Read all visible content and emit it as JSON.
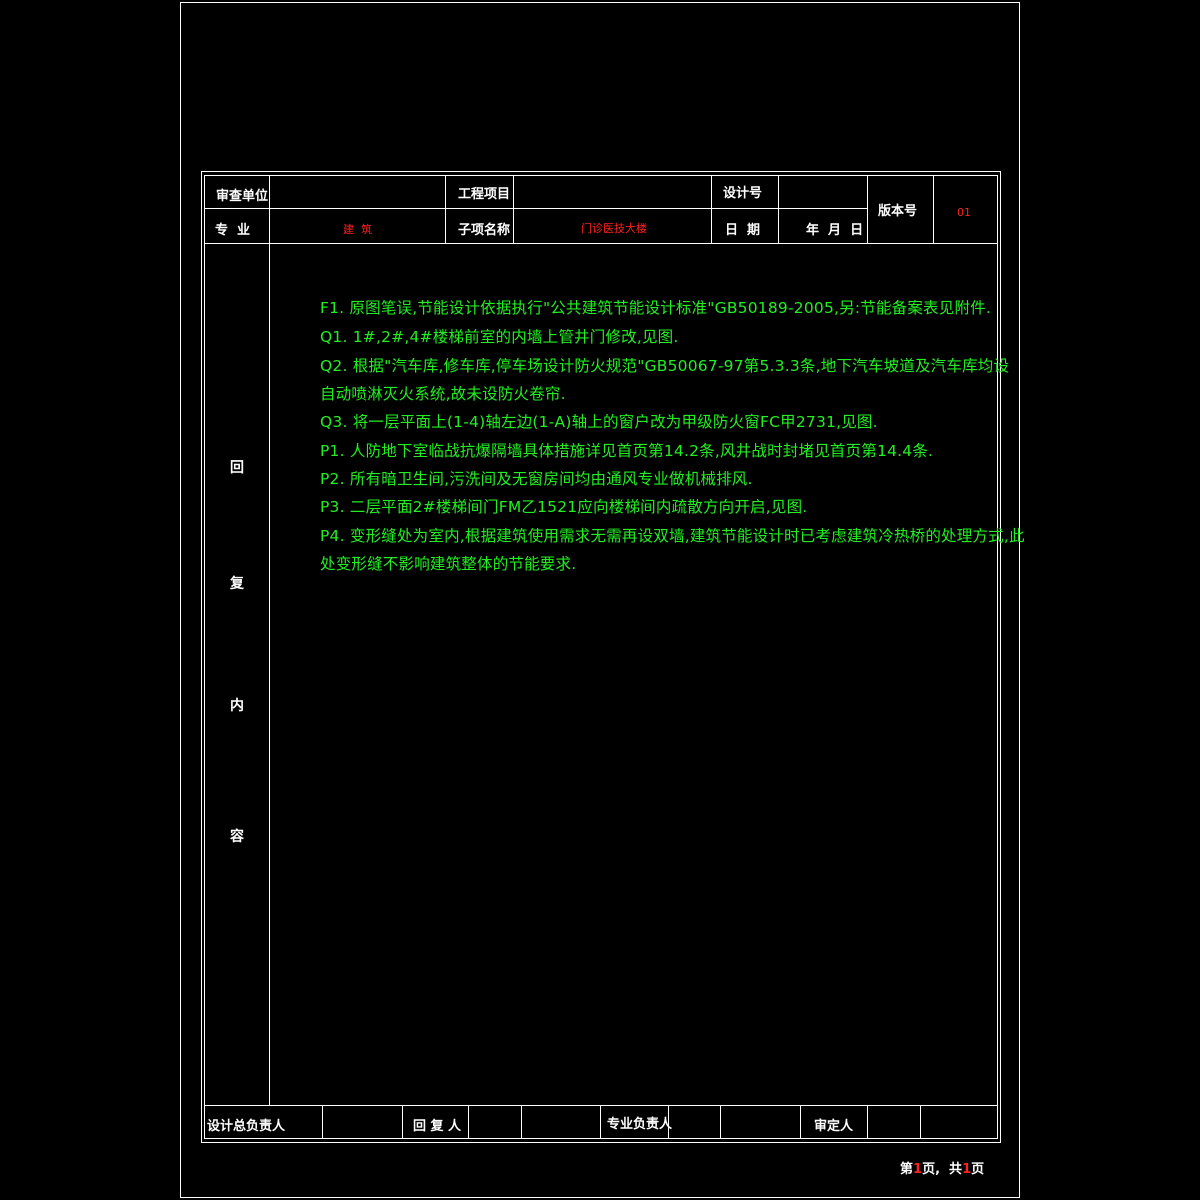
{
  "header": {
    "review_unit_label": "审查单位",
    "project_label": "工程项目",
    "design_no_label": "设计号",
    "version_label": "版本号",
    "version_value": "01",
    "discipline_label": "专  业",
    "discipline_value": "建  筑",
    "subproject_label": "子项名称",
    "subproject_value": "门诊医技大楼",
    "date_label": "日  期",
    "date_value": "年  月  日"
  },
  "side_label": [
    "回",
    "复",
    "内",
    "容"
  ],
  "content": [
    "F1.  原图笔误,节能设计依据执行\"公共建筑节能设计标准\"GB50189-2005,另:节能备案表见附件.",
    "Q1.  1#,2#,4#楼梯前室的内墙上管井门修改,见图.",
    "Q2.  根据\"汽车库,修车库,停车场设计防火规范\"GB50067-97第5.3.3条,地下汽车坡道及汽车库均设",
    "自动喷淋灭火系统,故未设防火卷帘.",
    "Q3.  将一层平面上(1-4)轴左边(1-A)轴上的窗户改为甲级防火窗FC甲2731,见图.",
    "P1.  人防地下室临战抗爆隔墙具体措施详见首页第14.2条,风井战时封堵见首页第14.4条.",
    "P2.  所有暗卫生间,污洗间及无窗房间均由通风专业做机械排风.",
    "P3.  二层平面2#楼梯间门FM乙1521应向楼梯间内疏散方向开启,见图.",
    "P4.  变形缝处为室内,根据建筑使用需求无需再设双墙,建筑节能设计时已考虑建筑冷热桥的处理方式,此",
    "处变形缝不影响建筑整体的节能要求."
  ],
  "footer": {
    "design_lead_label": "设计总负责人",
    "reply_person_label": "回 复 人",
    "discipline_lead_label": "专业负责人",
    "approver_label": "审定人",
    "page_prefix": "第",
    "page_current": "1",
    "page_mid": "页,  共",
    "page_total": "1",
    "page_suffix": "页"
  },
  "colors": {
    "background": "#000000",
    "lines": "#ffffff",
    "content_text": "#22ee22",
    "highlight": "#ff2020"
  }
}
